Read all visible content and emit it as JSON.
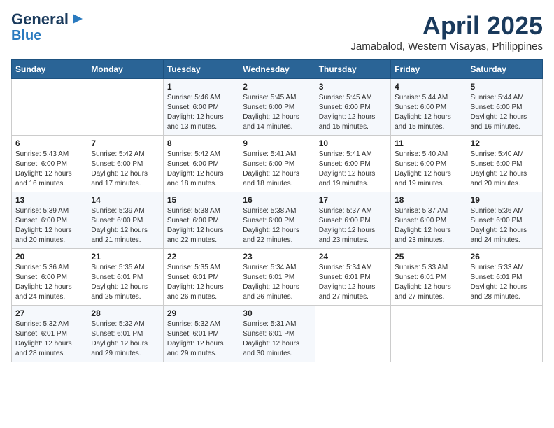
{
  "header": {
    "logo_line1": "General",
    "logo_line2": "Blue",
    "month_title": "April 2025",
    "location": "Jamabalod, Western Visayas, Philippines"
  },
  "days_of_week": [
    "Sunday",
    "Monday",
    "Tuesday",
    "Wednesday",
    "Thursday",
    "Friday",
    "Saturday"
  ],
  "weeks": [
    [
      {
        "day": "",
        "info": ""
      },
      {
        "day": "",
        "info": ""
      },
      {
        "day": "1",
        "info": "Sunrise: 5:46 AM\nSunset: 6:00 PM\nDaylight: 12 hours\nand 13 minutes."
      },
      {
        "day": "2",
        "info": "Sunrise: 5:45 AM\nSunset: 6:00 PM\nDaylight: 12 hours\nand 14 minutes."
      },
      {
        "day": "3",
        "info": "Sunrise: 5:45 AM\nSunset: 6:00 PM\nDaylight: 12 hours\nand 15 minutes."
      },
      {
        "day": "4",
        "info": "Sunrise: 5:44 AM\nSunset: 6:00 PM\nDaylight: 12 hours\nand 15 minutes."
      },
      {
        "day": "5",
        "info": "Sunrise: 5:44 AM\nSunset: 6:00 PM\nDaylight: 12 hours\nand 16 minutes."
      }
    ],
    [
      {
        "day": "6",
        "info": "Sunrise: 5:43 AM\nSunset: 6:00 PM\nDaylight: 12 hours\nand 16 minutes."
      },
      {
        "day": "7",
        "info": "Sunrise: 5:42 AM\nSunset: 6:00 PM\nDaylight: 12 hours\nand 17 minutes."
      },
      {
        "day": "8",
        "info": "Sunrise: 5:42 AM\nSunset: 6:00 PM\nDaylight: 12 hours\nand 18 minutes."
      },
      {
        "day": "9",
        "info": "Sunrise: 5:41 AM\nSunset: 6:00 PM\nDaylight: 12 hours\nand 18 minutes."
      },
      {
        "day": "10",
        "info": "Sunrise: 5:41 AM\nSunset: 6:00 PM\nDaylight: 12 hours\nand 19 minutes."
      },
      {
        "day": "11",
        "info": "Sunrise: 5:40 AM\nSunset: 6:00 PM\nDaylight: 12 hours\nand 19 minutes."
      },
      {
        "day": "12",
        "info": "Sunrise: 5:40 AM\nSunset: 6:00 PM\nDaylight: 12 hours\nand 20 minutes."
      }
    ],
    [
      {
        "day": "13",
        "info": "Sunrise: 5:39 AM\nSunset: 6:00 PM\nDaylight: 12 hours\nand 20 minutes."
      },
      {
        "day": "14",
        "info": "Sunrise: 5:39 AM\nSunset: 6:00 PM\nDaylight: 12 hours\nand 21 minutes."
      },
      {
        "day": "15",
        "info": "Sunrise: 5:38 AM\nSunset: 6:00 PM\nDaylight: 12 hours\nand 22 minutes."
      },
      {
        "day": "16",
        "info": "Sunrise: 5:38 AM\nSunset: 6:00 PM\nDaylight: 12 hours\nand 22 minutes."
      },
      {
        "day": "17",
        "info": "Sunrise: 5:37 AM\nSunset: 6:00 PM\nDaylight: 12 hours\nand 23 minutes."
      },
      {
        "day": "18",
        "info": "Sunrise: 5:37 AM\nSunset: 6:00 PM\nDaylight: 12 hours\nand 23 minutes."
      },
      {
        "day": "19",
        "info": "Sunrise: 5:36 AM\nSunset: 6:00 PM\nDaylight: 12 hours\nand 24 minutes."
      }
    ],
    [
      {
        "day": "20",
        "info": "Sunrise: 5:36 AM\nSunset: 6:00 PM\nDaylight: 12 hours\nand 24 minutes."
      },
      {
        "day": "21",
        "info": "Sunrise: 5:35 AM\nSunset: 6:01 PM\nDaylight: 12 hours\nand 25 minutes."
      },
      {
        "day": "22",
        "info": "Sunrise: 5:35 AM\nSunset: 6:01 PM\nDaylight: 12 hours\nand 26 minutes."
      },
      {
        "day": "23",
        "info": "Sunrise: 5:34 AM\nSunset: 6:01 PM\nDaylight: 12 hours\nand 26 minutes."
      },
      {
        "day": "24",
        "info": "Sunrise: 5:34 AM\nSunset: 6:01 PM\nDaylight: 12 hours\nand 27 minutes."
      },
      {
        "day": "25",
        "info": "Sunrise: 5:33 AM\nSunset: 6:01 PM\nDaylight: 12 hours\nand 27 minutes."
      },
      {
        "day": "26",
        "info": "Sunrise: 5:33 AM\nSunset: 6:01 PM\nDaylight: 12 hours\nand 28 minutes."
      }
    ],
    [
      {
        "day": "27",
        "info": "Sunrise: 5:32 AM\nSunset: 6:01 PM\nDaylight: 12 hours\nand 28 minutes."
      },
      {
        "day": "28",
        "info": "Sunrise: 5:32 AM\nSunset: 6:01 PM\nDaylight: 12 hours\nand 29 minutes."
      },
      {
        "day": "29",
        "info": "Sunrise: 5:32 AM\nSunset: 6:01 PM\nDaylight: 12 hours\nand 29 minutes."
      },
      {
        "day": "30",
        "info": "Sunrise: 5:31 AM\nSunset: 6:01 PM\nDaylight: 12 hours\nand 30 minutes."
      },
      {
        "day": "",
        "info": ""
      },
      {
        "day": "",
        "info": ""
      },
      {
        "day": "",
        "info": ""
      }
    ]
  ]
}
